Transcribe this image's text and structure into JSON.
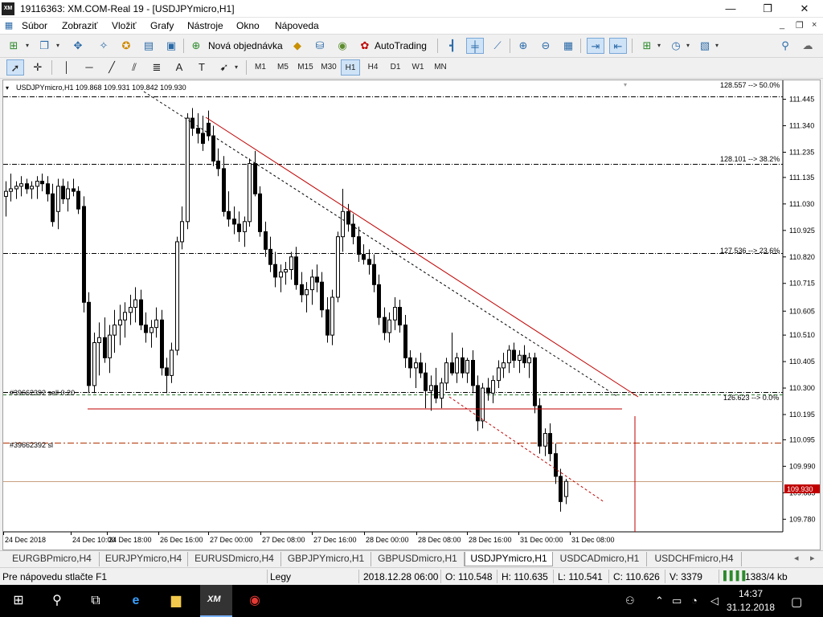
{
  "window": {
    "title": "19116363: XM.COM-Real 19 - [USDJPYmicro,H1]",
    "app_icon_text": "XM",
    "minimize_glyph": "—",
    "maximize_glyph": "❐",
    "close_glyph": "✕"
  },
  "menu": {
    "items": [
      "Súbor",
      "Zobraziť",
      "Vložiť",
      "Grafy",
      "Nástroje",
      "Okno",
      "Nápoveda"
    ],
    "mdi_controls": [
      "_",
      "❐",
      "×"
    ]
  },
  "toolbar": {
    "new_order_label": "Nová objednávka",
    "autotrading_label": "AutoTrading",
    "icons": [
      "new-chart-icon",
      "profiles-icon",
      "crosshair-move-icon",
      "navigator-icon",
      "market-watch-icon",
      "terminal-icon",
      "tester-icon",
      "new-order-icon",
      "metaeditor-icon",
      "signals-icon",
      "autotrading-icon",
      "bar-chart-icon",
      "candlestick-icon",
      "line-chart-icon",
      "zoom-in-icon",
      "zoom-out-icon",
      "tile-windows-icon",
      "chart-shift-icon",
      "auto-scroll-icon",
      "indicators-icon",
      "periods-icon",
      "templates-icon",
      "search-icon",
      "chat-icon"
    ]
  },
  "drawing_toolbar": {
    "tools": [
      "cursor",
      "crosshair",
      "vertical-line",
      "horizontal-line",
      "trend-line",
      "equidistant-channel",
      "fibonacci",
      "text",
      "text-label",
      "arrows"
    ],
    "timeframes": [
      "M1",
      "M5",
      "M15",
      "M30",
      "H1",
      "H4",
      "D1",
      "W1",
      "MN"
    ],
    "active_timeframe": "H1"
  },
  "chart": {
    "header": "USDJPYmicro,H1  109.868 109.931 109.842 109.930",
    "current_price": "109.930",
    "order_label_sell": "#39662392 sell 0.20",
    "order_label_sl": "#39662392 sl",
    "fib_labels": [
      "128.557 --> 50.0%",
      "128.101 --> 38.2%",
      "127.536 --> 23.6%",
      "126.623 --> 0.0%"
    ],
    "price_ticks": [
      "111.445",
      "111.340",
      "111.235",
      "111.135",
      "111.030",
      "110.925",
      "110.820",
      "110.715",
      "110.605",
      "110.510",
      "110.405",
      "110.300",
      "110.195",
      "110.095",
      "109.990",
      "109.885",
      "109.780"
    ],
    "time_ticks": [
      "24 Dec 2018",
      "24 Dec 10:00",
      "24 Dec 18:00",
      "26 Dec 16:00",
      "27 Dec 00:00",
      "27 Dec 08:00",
      "27 Dec 16:00",
      "28 Dec 00:00",
      "28 Dec 08:00",
      "28 Dec 16:00",
      "31 Dec 00:00",
      "31 Dec 08:00"
    ],
    "colors": {
      "bull": "#ffffff",
      "bear": "#000000",
      "trendline": "#c00000",
      "current_price_bg": "#c00000",
      "order_line": "#2e7d32",
      "sl_line": "#b03000"
    }
  },
  "chart_data": {
    "type": "candlestick",
    "title": "USDJPYmicro,H1",
    "ylim": [
      109.73,
      111.52
    ],
    "series": [
      {
        "name": "USDJPYmicro,H1",
        "ohlc": [
          [
            111.06,
            111.12,
            110.98,
            111.08
          ],
          [
            111.08,
            111.15,
            111.04,
            111.09
          ],
          [
            111.09,
            111.12,
            111.05,
            111.1
          ],
          [
            111.1,
            111.14,
            111.06,
            111.11
          ],
          [
            111.11,
            111.13,
            111.07,
            111.09
          ],
          [
            111.09,
            111.12,
            111.05,
            111.1
          ],
          [
            111.1,
            111.14,
            111.05,
            111.12
          ],
          [
            111.12,
            111.15,
            111.08,
            111.11
          ],
          [
            111.11,
            111.14,
            111.04,
            111.07
          ],
          [
            111.07,
            111.11,
            110.94,
            110.96
          ],
          [
            111.0,
            111.13,
            110.93,
            111.1
          ],
          [
            111.1,
            111.13,
            111.03,
            111.05
          ],
          [
            111.05,
            111.12,
            111.0,
            111.09
          ],
          [
            111.09,
            111.13,
            111.06,
            111.08
          ],
          [
            111.08,
            111.1,
            110.99,
            111.01
          ],
          [
            111.02,
            111.06,
            110.6,
            110.64
          ],
          [
            110.64,
            110.68,
            110.28,
            110.31
          ],
          [
            110.31,
            110.52,
            110.28,
            110.48
          ],
          [
            110.48,
            110.56,
            110.35,
            110.5
          ],
          [
            110.5,
            110.58,
            110.4,
            110.42
          ],
          [
            110.42,
            110.55,
            110.36,
            110.51
          ],
          [
            110.51,
            110.61,
            110.44,
            110.55
          ],
          [
            110.55,
            110.63,
            110.47,
            110.57
          ],
          [
            110.57,
            110.64,
            110.5,
            110.6
          ],
          [
            110.6,
            110.67,
            110.55,
            110.62
          ],
          [
            110.62,
            110.7,
            110.56,
            110.65
          ],
          [
            110.65,
            110.69,
            110.53,
            110.55
          ],
          [
            110.55,
            110.6,
            110.48,
            110.52
          ],
          [
            110.52,
            110.57,
            110.46,
            110.54
          ],
          [
            110.54,
            110.62,
            110.5,
            110.57
          ],
          [
            110.57,
            110.61,
            110.35,
            110.38
          ],
          [
            110.38,
            110.42,
            110.28,
            110.35
          ],
          [
            110.35,
            110.48,
            110.32,
            110.45
          ],
          [
            110.45,
            110.9,
            110.43,
            110.88
          ],
          [
            110.88,
            111.02,
            110.85,
            110.96
          ],
          [
            110.96,
            111.39,
            110.93,
            111.37
          ],
          [
            111.37,
            111.41,
            111.3,
            111.33
          ],
          [
            111.33,
            111.39,
            111.27,
            111.31
          ],
          [
            111.31,
            111.38,
            111.24,
            111.27
          ],
          [
            111.35,
            111.4,
            111.28,
            111.3
          ],
          [
            111.3,
            111.34,
            111.18,
            111.2
          ],
          [
            111.2,
            111.25,
            111.14,
            111.17
          ],
          [
            111.17,
            111.22,
            110.98,
            111.0
          ],
          [
            111.0,
            111.08,
            110.94,
            110.97
          ],
          [
            110.97,
            111.02,
            110.91,
            110.95
          ],
          [
            110.95,
            111.0,
            110.88,
            110.92
          ],
          [
            110.92,
            110.98,
            110.86,
            110.96
          ],
          [
            110.96,
            111.21,
            110.94,
            111.19
          ],
          [
            111.19,
            111.24,
            111.06,
            111.07
          ],
          [
            111.07,
            111.1,
            110.9,
            110.92
          ],
          [
            110.92,
            110.96,
            110.82,
            110.85
          ],
          [
            110.85,
            110.9,
            110.76,
            110.79
          ],
          [
            110.79,
            110.84,
            110.7,
            110.74
          ],
          [
            110.74,
            110.79,
            110.68,
            110.76
          ],
          [
            110.76,
            110.8,
            110.71,
            110.77
          ],
          [
            110.77,
            110.84,
            110.73,
            110.82
          ],
          [
            110.82,
            110.86,
            110.69,
            110.71
          ],
          [
            110.71,
            110.76,
            110.64,
            110.67
          ],
          [
            110.67,
            110.72,
            110.6,
            110.69
          ],
          [
            110.69,
            110.77,
            110.63,
            110.74
          ],
          [
            110.74,
            110.79,
            110.68,
            110.72
          ],
          [
            110.72,
            110.76,
            110.58,
            110.61
          ],
          [
            110.61,
            110.66,
            110.48,
            110.51
          ],
          [
            110.51,
            110.69,
            110.47,
            110.66
          ],
          [
            110.66,
            110.92,
            110.64,
            110.9
          ],
          [
            110.9,
            111.09,
            110.84,
            111.0
          ],
          [
            111.0,
            111.03,
            110.92,
            110.95
          ],
          [
            110.95,
            110.99,
            110.87,
            110.9
          ],
          [
            110.9,
            110.94,
            110.8,
            110.83
          ],
          [
            110.83,
            110.87,
            110.79,
            110.81
          ],
          [
            110.81,
            110.85,
            110.75,
            110.79
          ],
          [
            110.79,
            110.83,
            110.68,
            110.71
          ],
          [
            110.71,
            110.75,
            110.55,
            110.58
          ],
          [
            110.58,
            110.62,
            110.49,
            110.52
          ],
          [
            110.52,
            110.6,
            110.48,
            110.57
          ],
          [
            110.57,
            110.66,
            110.53,
            110.62
          ],
          [
            110.62,
            110.65,
            110.52,
            110.55
          ],
          [
            110.55,
            110.59,
            110.38,
            110.42
          ],
          [
            110.42,
            110.45,
            110.34,
            110.38
          ],
          [
            110.38,
            110.42,
            110.3,
            110.4
          ],
          [
            110.4,
            110.44,
            110.34,
            110.36
          ],
          [
            110.36,
            110.4,
            110.22,
            110.29
          ],
          [
            110.29,
            110.35,
            110.21,
            110.31
          ],
          [
            110.31,
            110.38,
            110.24,
            110.26
          ],
          [
            110.26,
            110.34,
            110.22,
            110.32
          ],
          [
            110.32,
            110.42,
            110.29,
            110.4
          ],
          [
            110.4,
            110.52,
            110.35,
            110.36
          ],
          [
            110.36,
            110.44,
            110.32,
            110.42
          ],
          [
            110.42,
            110.46,
            110.34,
            110.36
          ],
          [
            110.36,
            110.42,
            110.32,
            110.41
          ],
          [
            110.41,
            110.45,
            110.28,
            110.31
          ],
          [
            110.31,
            110.35,
            110.13,
            110.17
          ],
          [
            110.17,
            110.32,
            110.14,
            110.3
          ],
          [
            110.3,
            110.34,
            110.25,
            110.28
          ],
          [
            110.28,
            110.35,
            110.24,
            110.33
          ],
          [
            110.33,
            110.41,
            110.3,
            110.38
          ],
          [
            110.38,
            110.44,
            110.34,
            110.4
          ],
          [
            110.4,
            110.47,
            110.36,
            110.45
          ],
          [
            110.45,
            110.48,
            110.38,
            110.41
          ],
          [
            110.41,
            110.45,
            110.36,
            110.43
          ],
          [
            110.43,
            110.47,
            110.38,
            110.4
          ],
          [
            110.4,
            110.44,
            110.34,
            110.42
          ],
          [
            110.42,
            110.44,
            110.2,
            110.23
          ],
          [
            110.23,
            110.26,
            110.04,
            110.07
          ],
          [
            110.07,
            110.14,
            110.03,
            110.12
          ],
          [
            110.12,
            110.16,
            110.01,
            110.04
          ],
          [
            110.04,
            110.08,
            109.92,
            109.95
          ],
          [
            109.95,
            109.98,
            109.81,
            109.85
          ],
          [
            109.87,
            109.94,
            109.84,
            109.93
          ]
        ]
      }
    ],
    "fibonacci_levels": [
      {
        "label": "128.557 --> 50.0%",
        "price": 111.455
      },
      {
        "label": "128.101 --> 38.2%",
        "price": 111.19
      },
      {
        "label": "127.536 --> 23.6%",
        "price": 110.835
      },
      {
        "label": "126.623 --> 0.0%",
        "price": 110.285
      }
    ],
    "order_levels": [
      {
        "label": "#39662392 sell 0.20",
        "price": 110.285
      },
      {
        "label": "#39662392 sl",
        "price": 110.085
      }
    ],
    "current_price": 109.93
  },
  "symbol_tabs": {
    "tabs": [
      "EURGBPmicro,H4",
      "EURJPYmicro,H4",
      "EURUSDmicro,H4",
      "GBPJPYmicro,H1",
      "GBPUSDmicro,H1",
      "USDJPYmicro,H1",
      "USDCADmicro,H1",
      "USDCHFmicro,H4"
    ],
    "active": "USDJPYmicro,H1",
    "scroll_left": "◂",
    "scroll_right": "▸"
  },
  "statusbar": {
    "help": "Pre nápovedu stlačte F1",
    "profile": "Legy",
    "datetime": "2018.12.28 06:00",
    "open": "O: 110.548",
    "high": "H: 110.635",
    "low": "L: 110.541",
    "close": "C: 110.626",
    "volume": "V: 3379",
    "traffic": "1383/4 kb"
  },
  "taskbar": {
    "xm_label": "XM",
    "clock_time": "14:37",
    "clock_date": "31.12.2018"
  }
}
